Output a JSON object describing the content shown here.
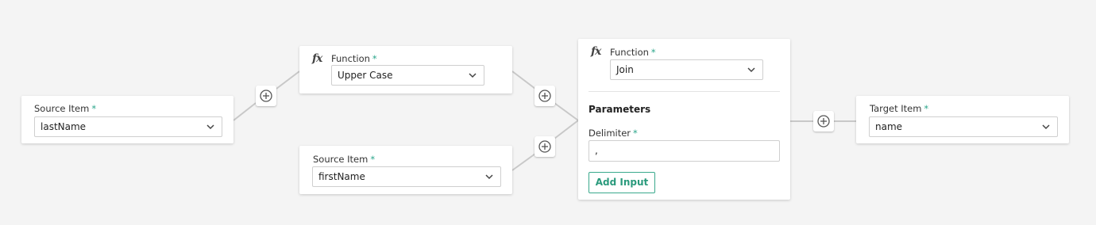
{
  "nodes": {
    "source_last": {
      "label": "Source Item",
      "required": "*",
      "value": "lastName"
    },
    "function_upper": {
      "label": "Function",
      "required": "*",
      "value": "Upper Case"
    },
    "source_first": {
      "label": "Source Item",
      "required": "*",
      "value": "firstName"
    },
    "function_join": {
      "label": "Function",
      "required": "*",
      "value": "Join",
      "parameters_title": "Parameters",
      "delimiter_label": "Delimiter",
      "delimiter_required": "*",
      "delimiter_value": ",",
      "add_input_label": "Add Input"
    },
    "target": {
      "label": "Target Item",
      "required": "*",
      "value": "name"
    }
  },
  "colors": {
    "accent": "#2aa58a",
    "wire": "#c8c8c8",
    "background": "#f4f4f4"
  },
  "icons": {
    "function": "fx-icon",
    "add": "plus-circle-icon",
    "dropdown": "chevron-down-icon"
  }
}
